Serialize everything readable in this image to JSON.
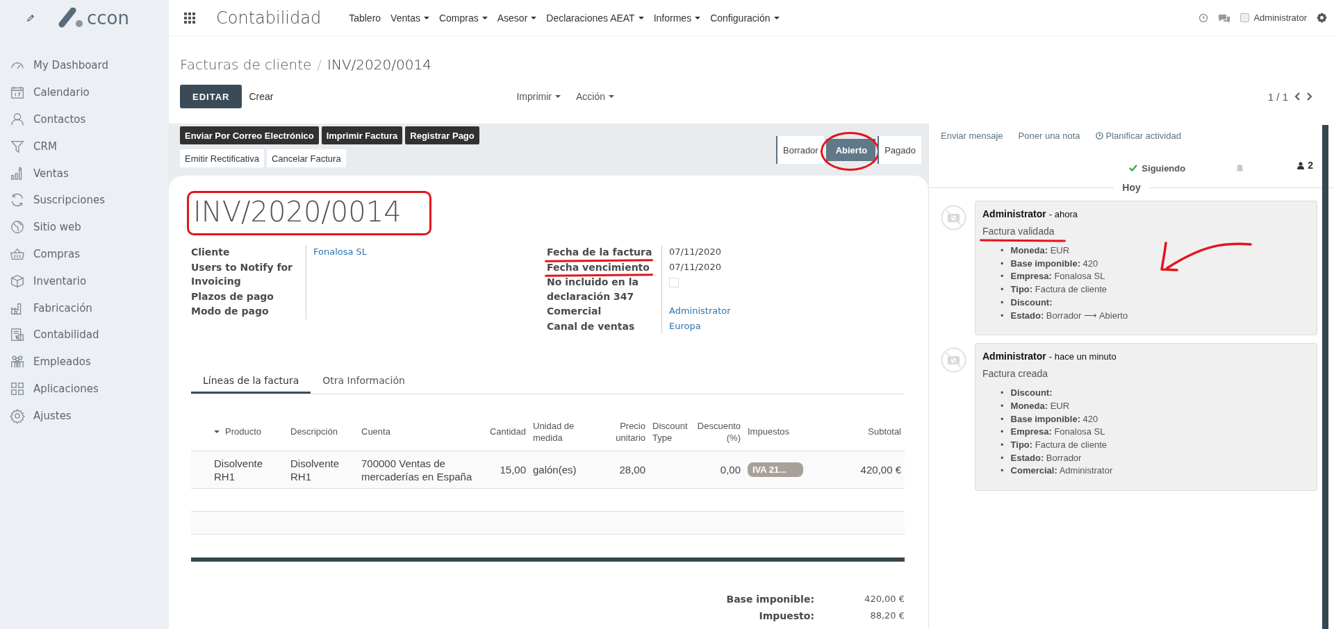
{
  "navbar": {
    "logo": "ccon",
    "app_title": "Contabilidad",
    "menu": [
      {
        "label": "Tablero",
        "dropdown": false
      },
      {
        "label": "Ventas",
        "dropdown": true
      },
      {
        "label": "Compras",
        "dropdown": true
      },
      {
        "label": "Asesor",
        "dropdown": true
      },
      {
        "label": "Declaraciones AEAT",
        "dropdown": true
      },
      {
        "label": "Informes",
        "dropdown": true
      },
      {
        "label": "Configuración",
        "dropdown": true
      }
    ],
    "user": "Administrator"
  },
  "sidebar": {
    "items": [
      {
        "label": "My Dashboard"
      },
      {
        "label": "Calendario"
      },
      {
        "label": "Contactos"
      },
      {
        "label": "CRM"
      },
      {
        "label": "Ventas"
      },
      {
        "label": "Suscripciones"
      },
      {
        "label": "Sitio web"
      },
      {
        "label": "Compras"
      },
      {
        "label": "Inventario"
      },
      {
        "label": "Fabricación"
      },
      {
        "label": "Contabilidad"
      },
      {
        "label": "Empleados"
      },
      {
        "label": "Aplicaciones"
      },
      {
        "label": "Ajustes"
      }
    ]
  },
  "breadcrumb": {
    "parent": "Facturas de cliente",
    "separator": "/",
    "current": "INV/2020/0014"
  },
  "control_buttons": [
    {
      "label": "EDITAR",
      "kind": "primary"
    },
    {
      "label": "Crear",
      "kind": "link"
    }
  ],
  "dropdowns": [
    "Imprimir",
    "Acción"
  ],
  "pager": "1 / 1",
  "action_buttons": [
    [
      {
        "label": "Enviar Por Correo Electrónico",
        "kind": "dark"
      },
      {
        "label": "Imprimir Factura",
        "kind": "dark"
      },
      {
        "label": "Registrar Pago",
        "kind": "dark"
      }
    ],
    [
      {
        "label": "Emitir Rectificativa",
        "kind": "light"
      },
      {
        "label": "Cancelar Factura",
        "kind": "light"
      }
    ]
  ],
  "status_steps": [
    {
      "label": "Borrador",
      "selected": false,
      "circled": false
    },
    {
      "label": "Abierto",
      "selected": true,
      "circled": true
    },
    {
      "label": "Pagado",
      "selected": false,
      "circled": false
    }
  ],
  "title": {
    "text": "INV/2020/0014",
    "boxed": true
  },
  "field_groups": [
    [
      {
        "label": "Cliente",
        "kind": "link",
        "value": "Fonalosa SL",
        "underlined": false
      },
      {
        "label": "Users to Notify for Invoicing",
        "kind": "empty",
        "underlined": false
      },
      {
        "label": "Plazos de pago",
        "kind": "empty",
        "underlined": false
      },
      {
        "label": "Modo de pago",
        "kind": "empty",
        "underlined": false
      }
    ],
    [
      {
        "label": "Fecha de la factura",
        "kind": "text",
        "value": "07/11/2020",
        "underlined": true
      },
      {
        "label": "Fecha vencimiento",
        "kind": "text",
        "value": "07/11/2020",
        "underlined": true
      },
      {
        "label": "No incluido en la declaración 347",
        "kind": "checkbox",
        "checked": false,
        "underlined": false
      },
      {
        "label": "Comercial",
        "kind": "link",
        "value": "Administrator",
        "underlined": false
      },
      {
        "label": "Canal de ventas",
        "kind": "link",
        "value": "Europa",
        "underlined": false
      }
    ]
  ],
  "tabs": [
    {
      "label": "Líneas de la factura",
      "selected": true
    },
    {
      "label": "Otra Información",
      "selected": false
    }
  ],
  "table": {
    "columns": [
      {
        "label": "Producto",
        "sorted": true
      },
      {
        "label": "Descripción",
        "sorted": false
      },
      {
        "label": "Cuenta",
        "sorted": false
      },
      {
        "label": "Cantidad",
        "sorted": false
      },
      {
        "label": "Unidad de medida",
        "sorted": false
      },
      {
        "label": "Precio unitario",
        "sorted": false
      },
      {
        "label": "Discount Type",
        "sorted": false
      },
      {
        "label": "Descuento (%)",
        "sorted": false
      },
      {
        "label": "Impuestos",
        "sorted": false
      },
      {
        "label": "Subtotal",
        "sorted": false
      }
    ],
    "rows": [
      {
        "product": "Disolvente RH1",
        "description": "Disolvente RH1",
        "account": "700000 Ventas de mercaderías en España",
        "quantity": "15,00",
        "uom": "galón(es)",
        "price": "28,00",
        "discount": "0,00",
        "taxes": [
          "IVA 21..."
        ],
        "subtotal": "420,00 €"
      }
    ]
  },
  "totals": [
    {
      "label": "Base imponible:",
      "value": "420,00 €"
    },
    {
      "label": "Impuesto:",
      "value": "88,20 €"
    }
  ],
  "chatter": {
    "actions": [
      {
        "label": "Enviar mensaje",
        "icon": false
      },
      {
        "label": "Poner una nota",
        "icon": false
      },
      {
        "label": "Planificar actividad",
        "icon": true
      }
    ],
    "following": "Siguiendo",
    "followers": "2",
    "day": "Hoy",
    "messages": [
      {
        "author": "Administrator",
        "time": "- ahora",
        "body": "Factura validada",
        "underlined": true,
        "arrow": true,
        "items": [
          {
            "bullet": "•",
            "text": "**Moneda:** EUR"
          },
          {
            "bullet": "•",
            "text": "**Base imponible:** 420"
          },
          {
            "bullet": "•",
            "text": "**Empresa:** Fonalosa SL"
          },
          {
            "bullet": "•",
            "text": "**Tipo:** Factura de cliente"
          },
          {
            "bullet": "•",
            "text": "**Discount:**"
          },
          {
            "bullet": "•",
            "text": "**Estado:** Borrador ⟶ Abierto"
          }
        ]
      },
      {
        "author": "Administrator",
        "time": "- hace un minuto",
        "body": "Factura creada",
        "underlined": false,
        "arrow": false,
        "items": [
          {
            "bullet": "•",
            "text": "**Discount:**"
          },
          {
            "bullet": "•",
            "text": "**Moneda:** EUR"
          },
          {
            "bullet": "•",
            "text": "**Base imponible:** 420"
          },
          {
            "bullet": "•",
            "text": "**Empresa:** Fonalosa SL"
          },
          {
            "bullet": "•",
            "text": "**Tipo:** Factura de cliente"
          },
          {
            "bullet": "•",
            "text": "**Estado:** Borrador"
          },
          {
            "bullet": "•",
            "text": "**Comercial:** Administrator"
          }
        ]
      }
    ]
  }
}
